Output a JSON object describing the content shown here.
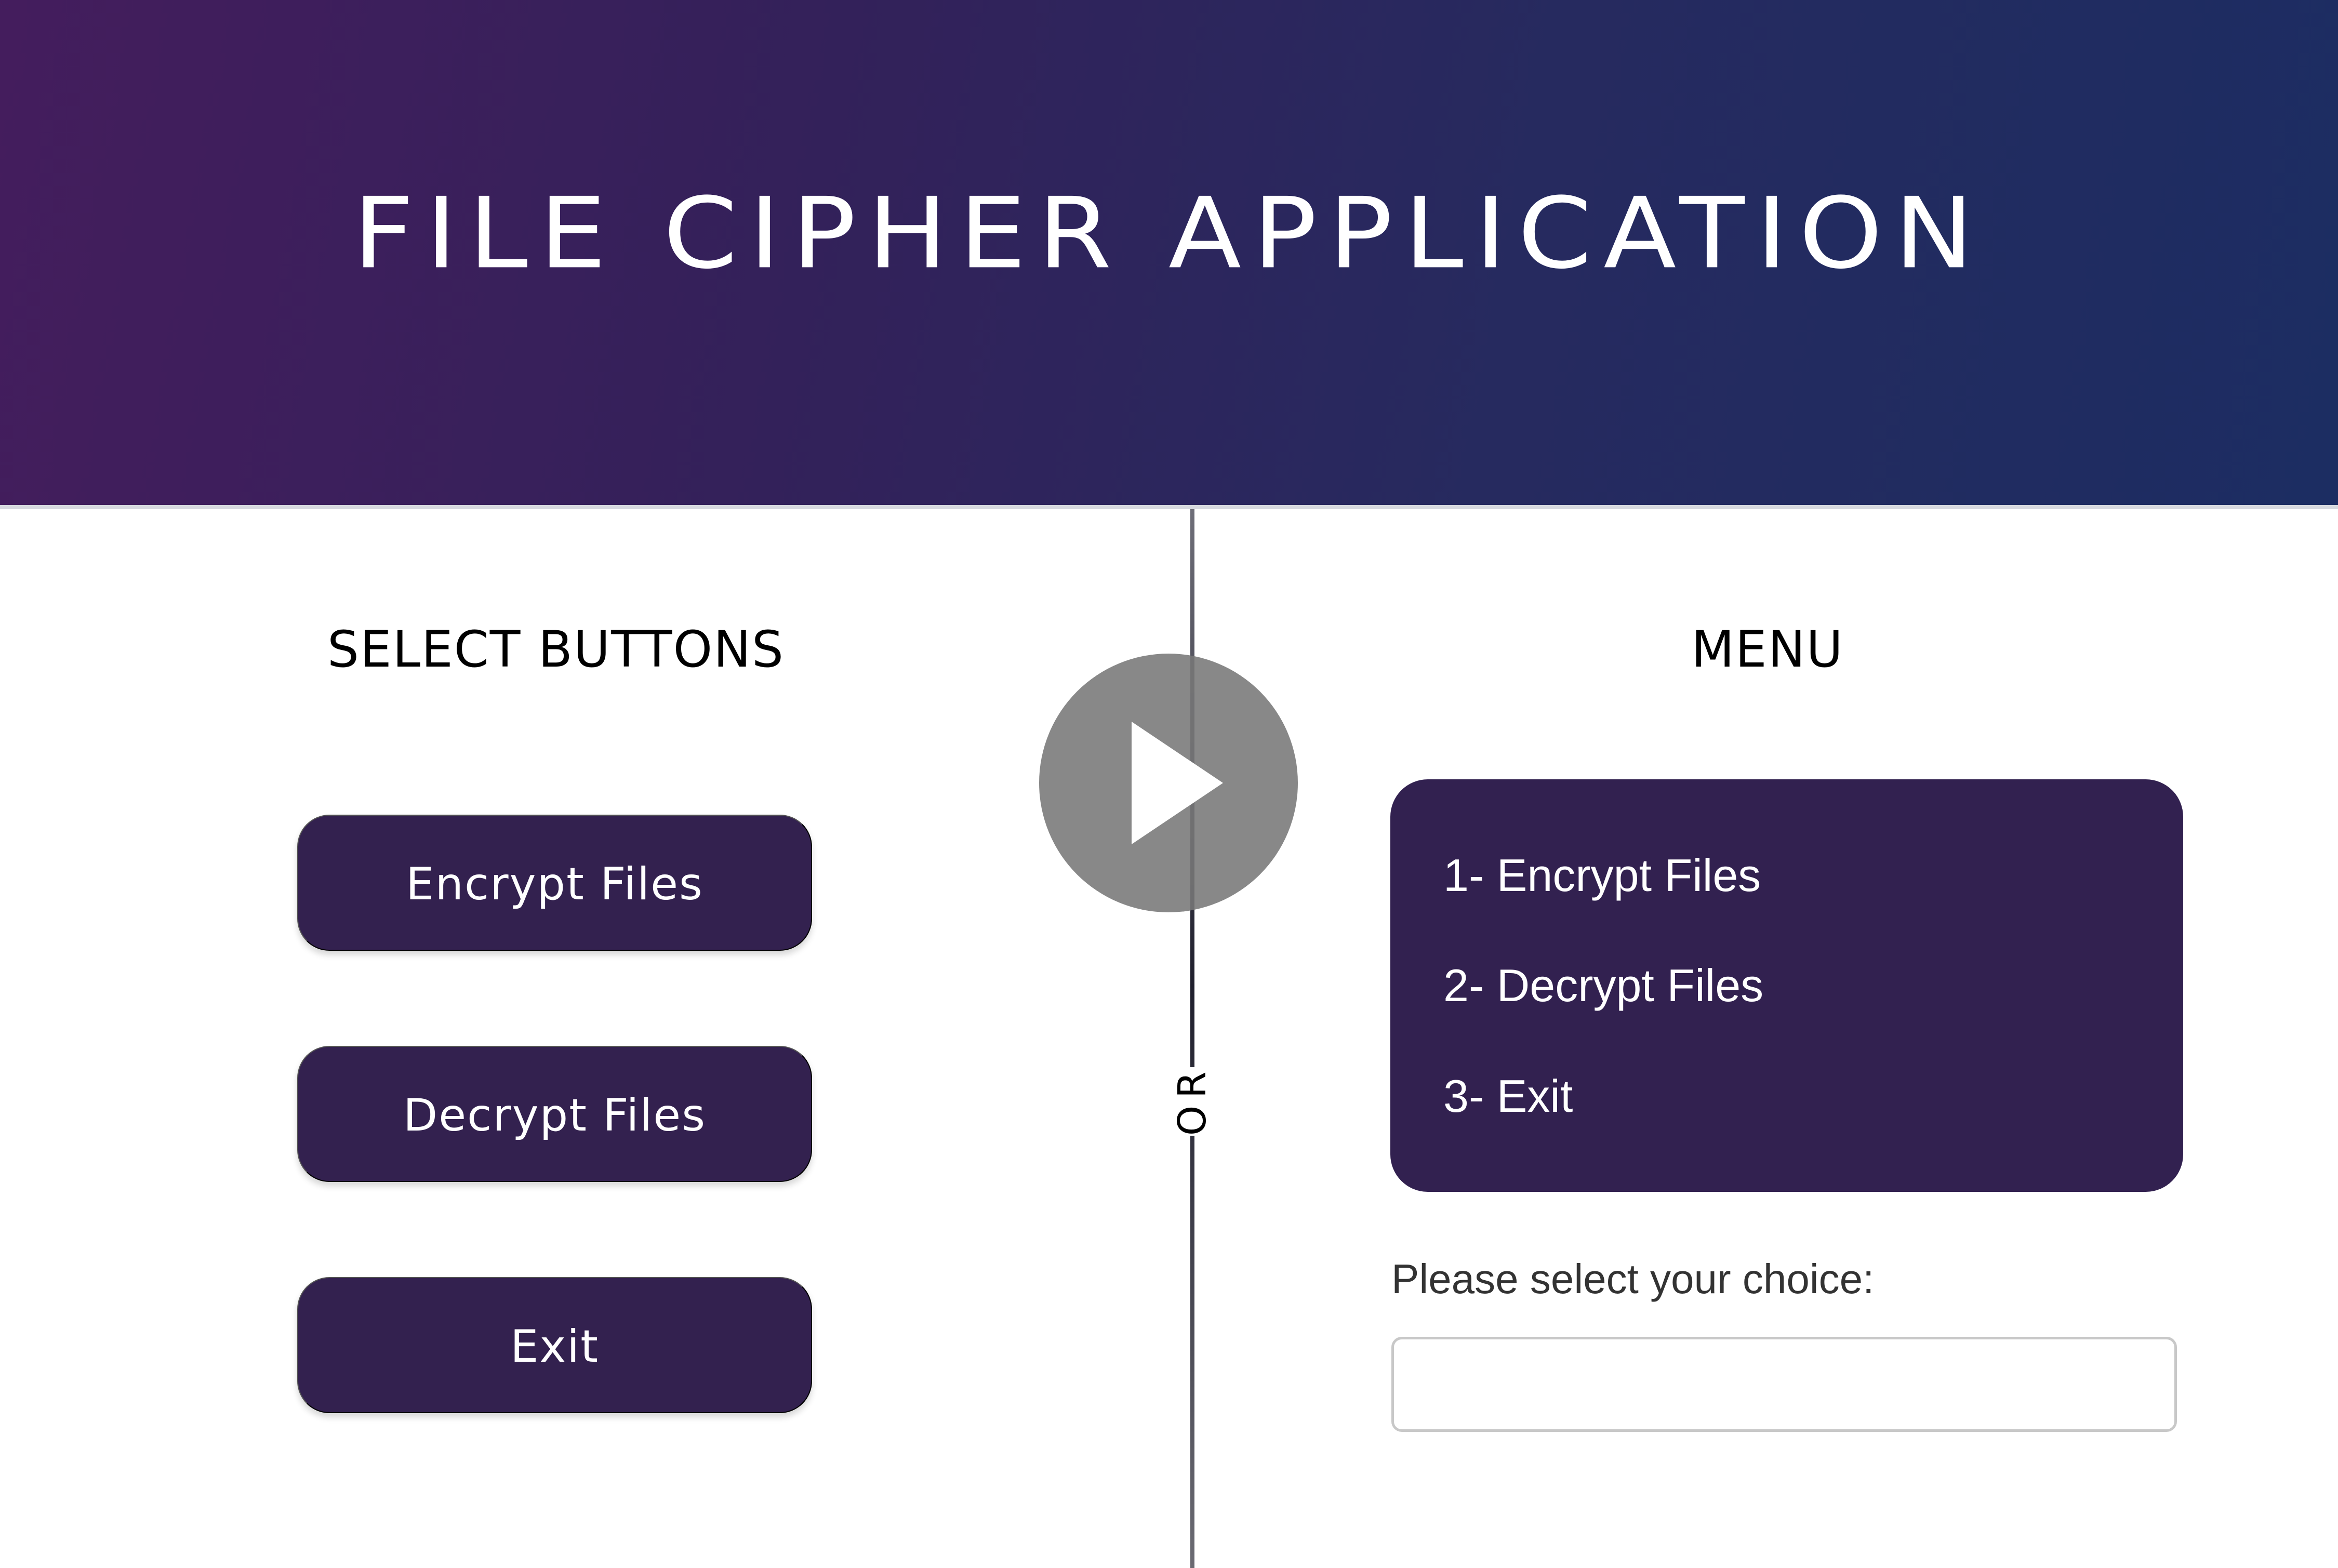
{
  "header": {
    "title": "FILE CIPHER APPLICATION"
  },
  "left_panel": {
    "title": "SELECT BUTTONS",
    "buttons": [
      {
        "label": "Encrypt Files"
      },
      {
        "label": "Decrypt Files"
      },
      {
        "label": "Exit"
      }
    ]
  },
  "divider": {
    "label": "OR"
  },
  "right_panel": {
    "title": "MENU",
    "menu_items": [
      {
        "label": "1- Encrypt Files"
      },
      {
        "label": "2- Decrypt Files"
      },
      {
        "label": "3- Exit"
      }
    ],
    "prompt": "Please select your choice:",
    "choice_value": ""
  },
  "overlay": {
    "icon": "play-icon"
  },
  "colors": {
    "header_gradient": [
      "#441d5d",
      "#1c2d62"
    ],
    "button_background": "#33214f",
    "menu_background": "#322150",
    "overlay": "#787878"
  }
}
